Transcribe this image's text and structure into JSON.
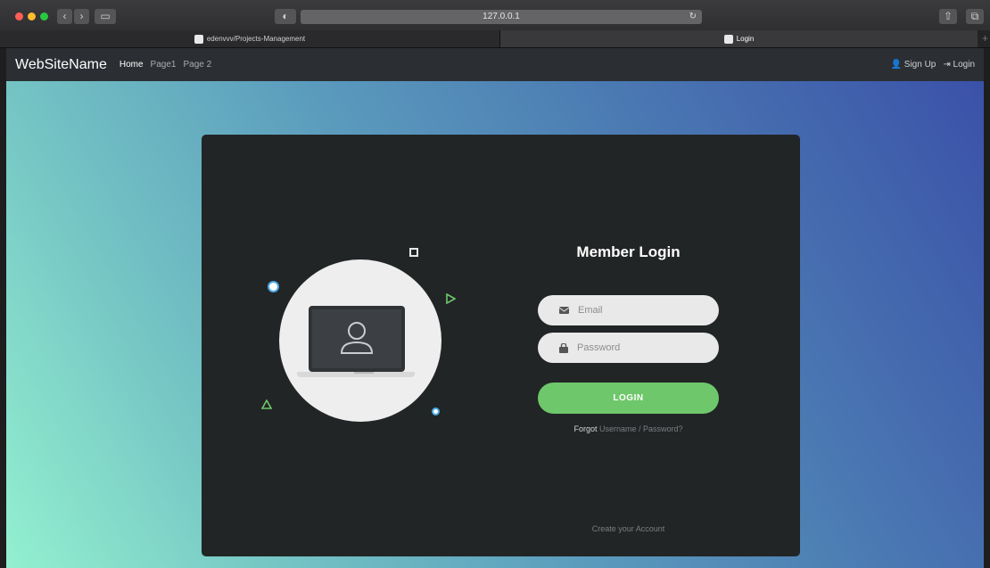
{
  "browser": {
    "url": "127.0.0.1",
    "tabs": [
      {
        "label": "edenvvv/Projects-Management",
        "active": false
      },
      {
        "label": "Login",
        "active": true
      }
    ]
  },
  "navbar": {
    "brand": "WebSiteName",
    "links": [
      "Home",
      "Page1",
      "Page 2"
    ],
    "right_links": [
      "Sign Up",
      "Login"
    ]
  },
  "login": {
    "title": "Member Login",
    "email_placeholder": "Email",
    "password_placeholder": "Password",
    "button_label": "LOGIN",
    "forgot_prefix": "Forgot",
    "forgot_link": "Username / Password?",
    "create_account": "Create your Account"
  },
  "colors": {
    "accent_green": "#6ec76a",
    "card_bg": "#222526",
    "navbar_bg": "#2b2f33",
    "dot_blue": "#4aa9e6"
  },
  "icons": [
    "user-icon",
    "signin-icon",
    "envelope-icon",
    "lock-icon",
    "laptop-user-icon"
  ]
}
